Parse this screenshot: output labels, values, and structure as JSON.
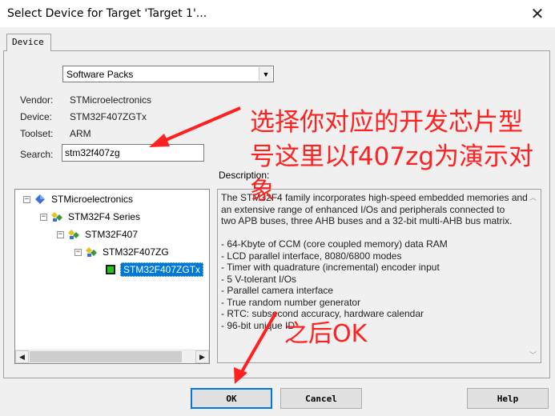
{
  "window": {
    "title": "Select Device for Target 'Target 1'...",
    "close_glyph": "✕"
  },
  "tab": {
    "label": "Device"
  },
  "packs_select": {
    "value": "Software Packs"
  },
  "info": {
    "vendor_label": "Vendor:",
    "vendor_value": "STMicroelectronics",
    "device_label": "Device:",
    "device_value": "STM32F407ZGTx",
    "toolset_label": "Toolset:",
    "toolset_value": "ARM",
    "search_label": "Search:",
    "search_value": "stm32f407zg"
  },
  "description": {
    "label": "Description:",
    "lines": [
      "The STM32F4 family incorporates high-speed embedded memories and",
      "an extensive range of enhanced I/Os and peripherals connected to",
      "two APB buses, three AHB buses and a 32-bit multi-AHB bus matrix.",
      "",
      "  - 64-Kbyte of CCM (core coupled memory) data RAM",
      "  - LCD parallel interface, 8080/6800 modes",
      "  - Timer with quadrature (incremental) encoder input",
      "  - 5 V-tolerant I/Os",
      "  - Parallel camera interface",
      "  - True random number generator",
      "  - RTC: subsecond accuracy, hardware calendar",
      "  - 96-bit unique ID"
    ]
  },
  "tree": {
    "items": [
      {
        "label": "STMicroelectronics",
        "expander": "−",
        "icon": "vendor-diamond-icon"
      },
      {
        "label": "STM32F4 Series",
        "expander": "−",
        "icon": "device-family-icon"
      },
      {
        "label": "STM32F407",
        "expander": "−",
        "icon": "device-family-icon"
      },
      {
        "label": "STM32F407ZG",
        "expander": "−",
        "icon": "device-family-icon"
      },
      {
        "label": "STM32F407ZGTx",
        "expander": "",
        "icon": "chip-icon",
        "selected": true
      }
    ]
  },
  "buttons": {
    "ok": "OK",
    "cancel": "Cancel",
    "help": "Help"
  },
  "annotations": {
    "line1": "选择你对应的开发芯片型",
    "line2": "号这里以f407zg为演示对",
    "line3": "象",
    "ok_note": "之后OK",
    "color": "#ff2020"
  },
  "colors": {
    "selection": "#0078d7",
    "chip_green": "#22c222"
  }
}
